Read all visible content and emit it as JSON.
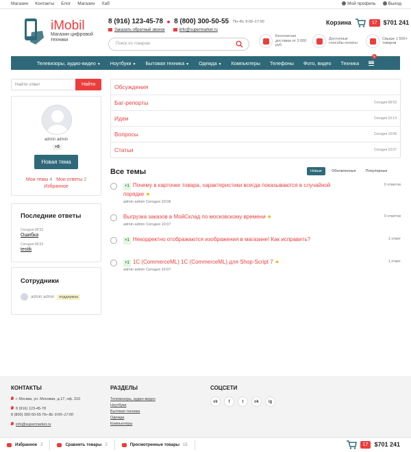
{
  "topbar": {
    "links": [
      "Магазин",
      "Контакты",
      "Блог",
      "Магазин",
      "Хаб"
    ],
    "profile": "Мой профиль",
    "logout": "Выход"
  },
  "logo": {
    "name": "iMobil",
    "tagline": "Магазин цифровой техники"
  },
  "contacts": {
    "phone1": "8 (916) 123-45-78",
    "phone2": "8 (800) 300-50-55",
    "hours": "Пн–Вс 9:00–17:00",
    "callback": "Заказать обратный звонок",
    "email": "info@supermarket.ru"
  },
  "search": {
    "placeholder": "Поиск по товарам"
  },
  "features": [
    {
      "text": "Бесплатная доставка от 3 000 руб.",
      "icon": "delivery-icon"
    },
    {
      "text": "Доступные способы оплаты",
      "icon": "wallet-icon"
    },
    {
      "text": "Свыше 1 500+ товаров",
      "icon": "thumbs-up-icon"
    }
  ],
  "cart": {
    "label": "Корзина",
    "count": "17",
    "sum": "$701 241"
  },
  "nav": {
    "items": [
      "Телевизоры, аудио-видео",
      "Ноутбуки",
      "Бытовая техника",
      "Одежда",
      "Компьютеры",
      "Телефоны",
      "Фото, видео",
      "Техника"
    ],
    "badge": "5"
  },
  "answer_search": {
    "placeholder": "Найти ответ",
    "button": "Найти"
  },
  "profile": {
    "name": "admin admin",
    "rating": "+0",
    "new_topic": "Новая тема",
    "my_topics": "Мои темы",
    "my_topics_count": "4",
    "my_answers": "Мои ответы",
    "my_answers_count": "2",
    "favorites": "Избранное"
  },
  "recent": {
    "title": "Последние ответы",
    "items": [
      {
        "date": "Сегодня 08:53",
        "label": "Ошибка"
      },
      {
        "date": "Сегодня 08:53",
        "label": "testik"
      }
    ]
  },
  "staff": {
    "title": "Сотрудники",
    "name": "admin admin",
    "tag": "поддержка"
  },
  "categories": [
    {
      "name": "Обсуждения",
      "date": ""
    },
    {
      "name": "Баг-репорты",
      "date": "Сегодня 08:53"
    },
    {
      "name": "Идеи",
      "date": "Сегодня 10:13"
    },
    {
      "name": "Вопросы",
      "date": "Сегодня 10:08"
    },
    {
      "name": "Статьи",
      "date": "Сегодня 10:07"
    }
  ],
  "all_topics": {
    "title": "Все темы",
    "tabs": [
      "Новые",
      "Обновленные",
      "Популярные"
    ],
    "items": [
      {
        "vote": "+1",
        "title": "Почему в карточке товара, характеристики всегда показываются в случайной порядке",
        "meta": "admin admin Сегодня 10:08",
        "count": "0 ответов",
        "icon": "question-icon"
      },
      {
        "vote": "",
        "title": "Выгрузка заказов в МойСклад по московскому времени",
        "meta": "admin admin Сегодня 10:07",
        "count": "0 ответов",
        "icon": "info-icon"
      },
      {
        "vote": "+1",
        "title": "Некорректно отображаются изображения в магазине! Как исправить?",
        "meta": "",
        "count": "1 ответ",
        "icon": "idea-icon"
      },
      {
        "vote": "+1",
        "title": "1С (CommerceML) 1С (CommerceML) для Shop-Script 7",
        "meta": "admin admin Сегодня 10:07",
        "count": "1 ответ",
        "icon": "bug-icon"
      }
    ]
  },
  "footer": {
    "contacts_title": "КОНТАКТЫ",
    "address": "г. Москва, ул. Моховая, д.17, оф. 310",
    "phone1": "8 (916) 123-45-78",
    "phone2": "8 (800) 300-50-55",
    "hours": "Пн–Вс 9:00–17:00",
    "email": "info@supermarket.ru",
    "sections_title": "РАЗДЕЛЫ",
    "sections": [
      "Телевизоры, аудио-видео",
      "Ноутбуки",
      "Бытовая техника",
      "Одежда",
      "Компьютеры"
    ],
    "social_title": "СОЦСЕТИ",
    "socials": [
      "vk",
      "f",
      "t",
      "ok",
      "ig"
    ]
  },
  "bottombar": {
    "favorites": "Избранное",
    "favorites_count": "2",
    "compare": "Сравнить товары",
    "compare_count": "2",
    "viewed": "Просмотренные товары",
    "viewed_count": "15",
    "cart_count": "17",
    "cart_sum": "$701 241"
  },
  "colors": {
    "accent": "#ec3d3d",
    "nav": "#2f6979"
  }
}
